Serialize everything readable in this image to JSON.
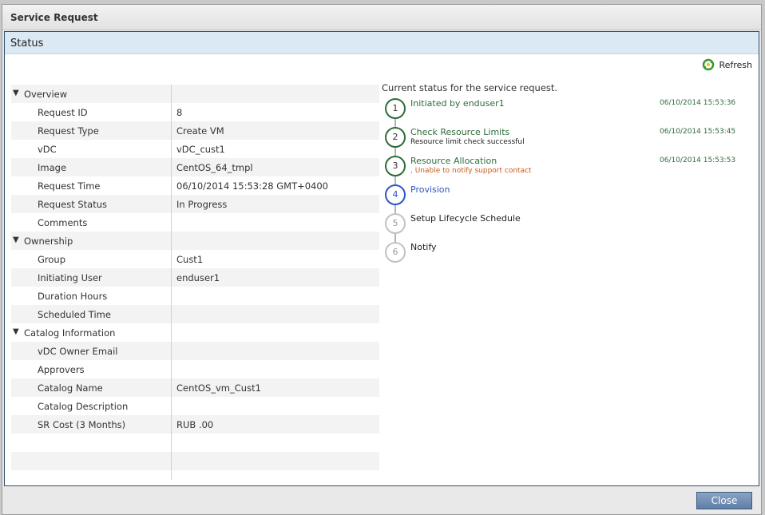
{
  "window": {
    "title": "Service Request"
  },
  "panel": {
    "title": "Status"
  },
  "toolbar": {
    "refresh_label": "Refresh"
  },
  "details": {
    "groups": [
      {
        "label": "Overview",
        "rows": [
          {
            "key": "Request ID",
            "value": "8"
          },
          {
            "key": "Request Type",
            "value": "Create VM"
          },
          {
            "key": "vDC",
            "value": "vDC_cust1"
          },
          {
            "key": "Image",
            "value": "CentOS_64_tmpl"
          },
          {
            "key": "Request Time",
            "value": "06/10/2014 15:53:28 GMT+0400"
          },
          {
            "key": "Request Status",
            "value": "In Progress"
          },
          {
            "key": "Comments",
            "value": ""
          }
        ]
      },
      {
        "label": "Ownership",
        "rows": [
          {
            "key": "Group",
            "value": "Cust1"
          },
          {
            "key": "Initiating User",
            "value": "enduser1"
          },
          {
            "key": "Duration Hours",
            "value": ""
          },
          {
            "key": "Scheduled Time",
            "value": ""
          }
        ]
      },
      {
        "label": "Catalog Information",
        "rows": [
          {
            "key": "vDC Owner Email",
            "value": ""
          },
          {
            "key": "Approvers",
            "value": ""
          },
          {
            "key": "Catalog Name",
            "value": "CentOS_vm_Cust1"
          },
          {
            "key": "Catalog Description",
            "value": ""
          },
          {
            "key": "SR Cost  (3 Months)",
            "value": "RUB .00"
          }
        ]
      }
    ]
  },
  "workflow": {
    "caption": "Current status for the service request.",
    "steps": [
      {
        "number": "1",
        "label": "Initiated by enduser1",
        "detail": "",
        "timestamp": "06/10/2014 15:53:36",
        "state": "completed"
      },
      {
        "number": "2",
        "label": "Check Resource Limits",
        "detail": "Resource limit check successful",
        "timestamp": "06/10/2014 15:53:45",
        "state": "completed"
      },
      {
        "number": "3",
        "label": "Resource Allocation",
        "detail": ", Unable to notify support contact",
        "timestamp": "06/10/2014 15:53:53",
        "state": "completed-warning"
      },
      {
        "number": "4",
        "label": "Provision",
        "detail": "",
        "timestamp": "",
        "state": "in-progress"
      },
      {
        "number": "5",
        "label": "Setup Lifecycle Schedule",
        "detail": "",
        "timestamp": "",
        "state": "pending"
      },
      {
        "number": "6",
        "label": "Notify",
        "detail": "",
        "timestamp": "",
        "state": "pending"
      }
    ]
  },
  "footer": {
    "close_label": "Close"
  },
  "colors": {
    "completed": "#2e6b3a",
    "in_progress": "#2d54c7",
    "pending": "#c2c2c2",
    "warning": "#cc5a16",
    "header_bg": "#dbe9f4"
  }
}
